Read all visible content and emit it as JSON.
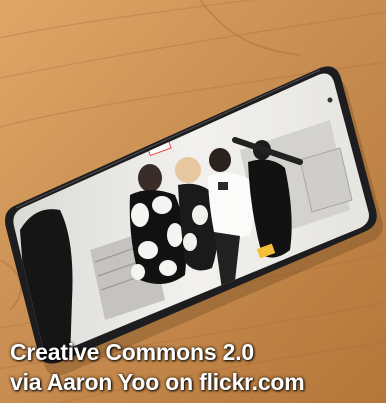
{
  "image": {
    "subject": "smartphone playing a video, lying on a wooden table",
    "caption_lines": [
      "Creative Commons 2.0",
      "via Aaron Yoo on flickr.com"
    ],
    "colors": {
      "wood": "#c98f52",
      "phone_frame": "#1d1d1f",
      "screen_bg": "#ecebe8",
      "caption_text": "#ffffff"
    }
  }
}
